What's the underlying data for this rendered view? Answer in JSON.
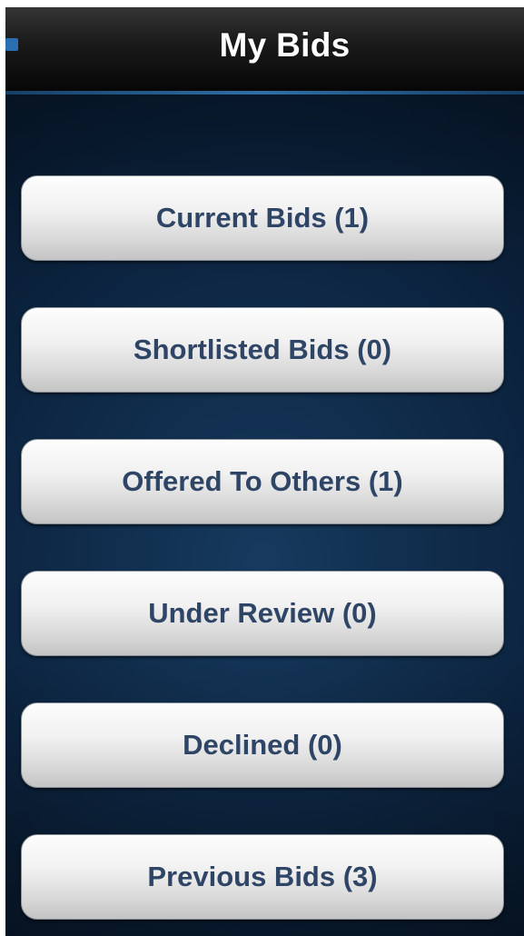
{
  "header": {
    "title": "My Bids"
  },
  "bid_categories": [
    {
      "label": "Current Bids (1)"
    },
    {
      "label": "Shortlisted Bids (0)"
    },
    {
      "label": "Offered To Others (1)"
    },
    {
      "label": "Under Review (0)"
    },
    {
      "label": "Declined (0)"
    },
    {
      "label": "Previous Bids (3)"
    }
  ],
  "colors": {
    "button_text": "#2f4566",
    "nav_accent": "#2f6fa5",
    "background": "#0c2440"
  }
}
